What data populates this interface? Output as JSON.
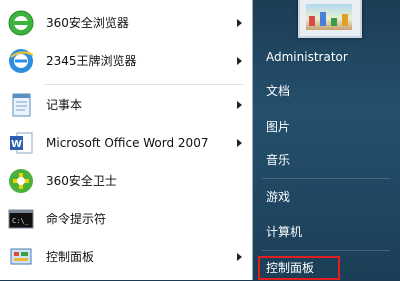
{
  "left_menu": [
    {
      "label": "360安全浏览器",
      "icon": "360-browser-icon",
      "submenu": true
    },
    {
      "label": "2345王牌浏览器",
      "icon": "2345-browser-icon",
      "submenu": true
    },
    {
      "label": "记事本",
      "icon": "notepad-icon",
      "submenu": true
    },
    {
      "label": "Microsoft Office Word 2007",
      "icon": "word-icon",
      "submenu": true
    },
    {
      "label": "360安全卫士",
      "icon": "360-security-icon",
      "submenu": false
    },
    {
      "label": "命令提示符",
      "icon": "cmd-icon",
      "submenu": false
    },
    {
      "label": "控制面板",
      "icon": "control-panel-icon",
      "submenu": true
    }
  ],
  "right_menu": {
    "user_name": "Administrator",
    "items": [
      "文档",
      "图片",
      "音乐",
      "游戏",
      "计算机",
      "控制面板"
    ]
  },
  "colors": {
    "highlight_border": "#e0201f",
    "right_panel": "#24506d"
  }
}
